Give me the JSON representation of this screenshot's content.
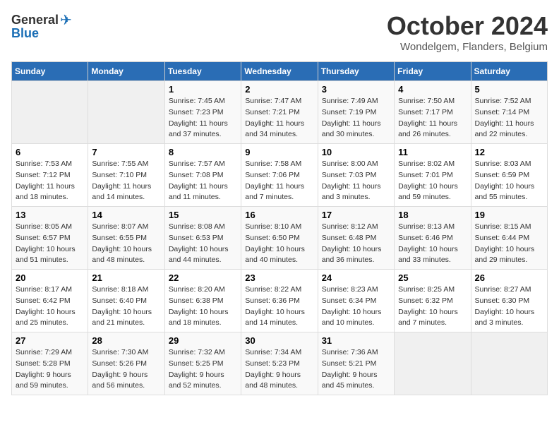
{
  "header": {
    "logo_general": "General",
    "logo_blue": "Blue",
    "title": "October 2024",
    "location": "Wondelgem, Flanders, Belgium"
  },
  "days_of_week": [
    "Sunday",
    "Monday",
    "Tuesday",
    "Wednesday",
    "Thursday",
    "Friday",
    "Saturday"
  ],
  "weeks": [
    [
      {
        "day": "",
        "sunrise": "",
        "sunset": "",
        "daylight": ""
      },
      {
        "day": "",
        "sunrise": "",
        "sunset": "",
        "daylight": ""
      },
      {
        "day": "1",
        "sunrise": "Sunrise: 7:45 AM",
        "sunset": "Sunset: 7:23 PM",
        "daylight": "Daylight: 11 hours and 37 minutes."
      },
      {
        "day": "2",
        "sunrise": "Sunrise: 7:47 AM",
        "sunset": "Sunset: 7:21 PM",
        "daylight": "Daylight: 11 hours and 34 minutes."
      },
      {
        "day": "3",
        "sunrise": "Sunrise: 7:49 AM",
        "sunset": "Sunset: 7:19 PM",
        "daylight": "Daylight: 11 hours and 30 minutes."
      },
      {
        "day": "4",
        "sunrise": "Sunrise: 7:50 AM",
        "sunset": "Sunset: 7:17 PM",
        "daylight": "Daylight: 11 hours and 26 minutes."
      },
      {
        "day": "5",
        "sunrise": "Sunrise: 7:52 AM",
        "sunset": "Sunset: 7:14 PM",
        "daylight": "Daylight: 11 hours and 22 minutes."
      }
    ],
    [
      {
        "day": "6",
        "sunrise": "Sunrise: 7:53 AM",
        "sunset": "Sunset: 7:12 PM",
        "daylight": "Daylight: 11 hours and 18 minutes."
      },
      {
        "day": "7",
        "sunrise": "Sunrise: 7:55 AM",
        "sunset": "Sunset: 7:10 PM",
        "daylight": "Daylight: 11 hours and 14 minutes."
      },
      {
        "day": "8",
        "sunrise": "Sunrise: 7:57 AM",
        "sunset": "Sunset: 7:08 PM",
        "daylight": "Daylight: 11 hours and 11 minutes."
      },
      {
        "day": "9",
        "sunrise": "Sunrise: 7:58 AM",
        "sunset": "Sunset: 7:06 PM",
        "daylight": "Daylight: 11 hours and 7 minutes."
      },
      {
        "day": "10",
        "sunrise": "Sunrise: 8:00 AM",
        "sunset": "Sunset: 7:03 PM",
        "daylight": "Daylight: 11 hours and 3 minutes."
      },
      {
        "day": "11",
        "sunrise": "Sunrise: 8:02 AM",
        "sunset": "Sunset: 7:01 PM",
        "daylight": "Daylight: 10 hours and 59 minutes."
      },
      {
        "day": "12",
        "sunrise": "Sunrise: 8:03 AM",
        "sunset": "Sunset: 6:59 PM",
        "daylight": "Daylight: 10 hours and 55 minutes."
      }
    ],
    [
      {
        "day": "13",
        "sunrise": "Sunrise: 8:05 AM",
        "sunset": "Sunset: 6:57 PM",
        "daylight": "Daylight: 10 hours and 51 minutes."
      },
      {
        "day": "14",
        "sunrise": "Sunrise: 8:07 AM",
        "sunset": "Sunset: 6:55 PM",
        "daylight": "Daylight: 10 hours and 48 minutes."
      },
      {
        "day": "15",
        "sunrise": "Sunrise: 8:08 AM",
        "sunset": "Sunset: 6:53 PM",
        "daylight": "Daylight: 10 hours and 44 minutes."
      },
      {
        "day": "16",
        "sunrise": "Sunrise: 8:10 AM",
        "sunset": "Sunset: 6:50 PM",
        "daylight": "Daylight: 10 hours and 40 minutes."
      },
      {
        "day": "17",
        "sunrise": "Sunrise: 8:12 AM",
        "sunset": "Sunset: 6:48 PM",
        "daylight": "Daylight: 10 hours and 36 minutes."
      },
      {
        "day": "18",
        "sunrise": "Sunrise: 8:13 AM",
        "sunset": "Sunset: 6:46 PM",
        "daylight": "Daylight: 10 hours and 33 minutes."
      },
      {
        "day": "19",
        "sunrise": "Sunrise: 8:15 AM",
        "sunset": "Sunset: 6:44 PM",
        "daylight": "Daylight: 10 hours and 29 minutes."
      }
    ],
    [
      {
        "day": "20",
        "sunrise": "Sunrise: 8:17 AM",
        "sunset": "Sunset: 6:42 PM",
        "daylight": "Daylight: 10 hours and 25 minutes."
      },
      {
        "day": "21",
        "sunrise": "Sunrise: 8:18 AM",
        "sunset": "Sunset: 6:40 PM",
        "daylight": "Daylight: 10 hours and 21 minutes."
      },
      {
        "day": "22",
        "sunrise": "Sunrise: 8:20 AM",
        "sunset": "Sunset: 6:38 PM",
        "daylight": "Daylight: 10 hours and 18 minutes."
      },
      {
        "day": "23",
        "sunrise": "Sunrise: 8:22 AM",
        "sunset": "Sunset: 6:36 PM",
        "daylight": "Daylight: 10 hours and 14 minutes."
      },
      {
        "day": "24",
        "sunrise": "Sunrise: 8:23 AM",
        "sunset": "Sunset: 6:34 PM",
        "daylight": "Daylight: 10 hours and 10 minutes."
      },
      {
        "day": "25",
        "sunrise": "Sunrise: 8:25 AM",
        "sunset": "Sunset: 6:32 PM",
        "daylight": "Daylight: 10 hours and 7 minutes."
      },
      {
        "day": "26",
        "sunrise": "Sunrise: 8:27 AM",
        "sunset": "Sunset: 6:30 PM",
        "daylight": "Daylight: 10 hours and 3 minutes."
      }
    ],
    [
      {
        "day": "27",
        "sunrise": "Sunrise: 7:29 AM",
        "sunset": "Sunset: 5:28 PM",
        "daylight": "Daylight: 9 hours and 59 minutes."
      },
      {
        "day": "28",
        "sunrise": "Sunrise: 7:30 AM",
        "sunset": "Sunset: 5:26 PM",
        "daylight": "Daylight: 9 hours and 56 minutes."
      },
      {
        "day": "29",
        "sunrise": "Sunrise: 7:32 AM",
        "sunset": "Sunset: 5:25 PM",
        "daylight": "Daylight: 9 hours and 52 minutes."
      },
      {
        "day": "30",
        "sunrise": "Sunrise: 7:34 AM",
        "sunset": "Sunset: 5:23 PM",
        "daylight": "Daylight: 9 hours and 48 minutes."
      },
      {
        "day": "31",
        "sunrise": "Sunrise: 7:36 AM",
        "sunset": "Sunset: 5:21 PM",
        "daylight": "Daylight: 9 hours and 45 minutes."
      },
      {
        "day": "",
        "sunrise": "",
        "sunset": "",
        "daylight": ""
      },
      {
        "day": "",
        "sunrise": "",
        "sunset": "",
        "daylight": ""
      }
    ]
  ]
}
